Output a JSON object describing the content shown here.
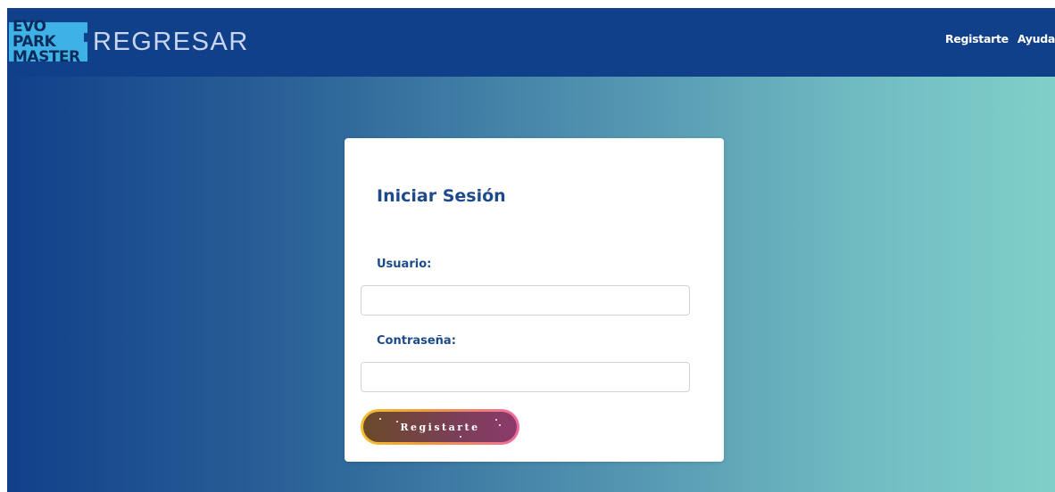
{
  "header": {
    "logo_line1": "EVO PARK",
    "logo_line2": "MASTER",
    "back_label": "REGRESAR",
    "nav": [
      {
        "label": "Registarte"
      },
      {
        "label": "Ayuda"
      }
    ]
  },
  "login": {
    "title": "Iniciar Sesión",
    "user_label": "Usuario:",
    "user_value": "",
    "password_label": "Contraseña:",
    "password_value": "",
    "submit_label": "Registarte"
  },
  "colors": {
    "navbar": "#11408a",
    "gradient_start": "#11408a",
    "gradient_end": "#80d0c9",
    "title_text": "#1c4a8a",
    "logo_bg": "#3eb2e6"
  }
}
